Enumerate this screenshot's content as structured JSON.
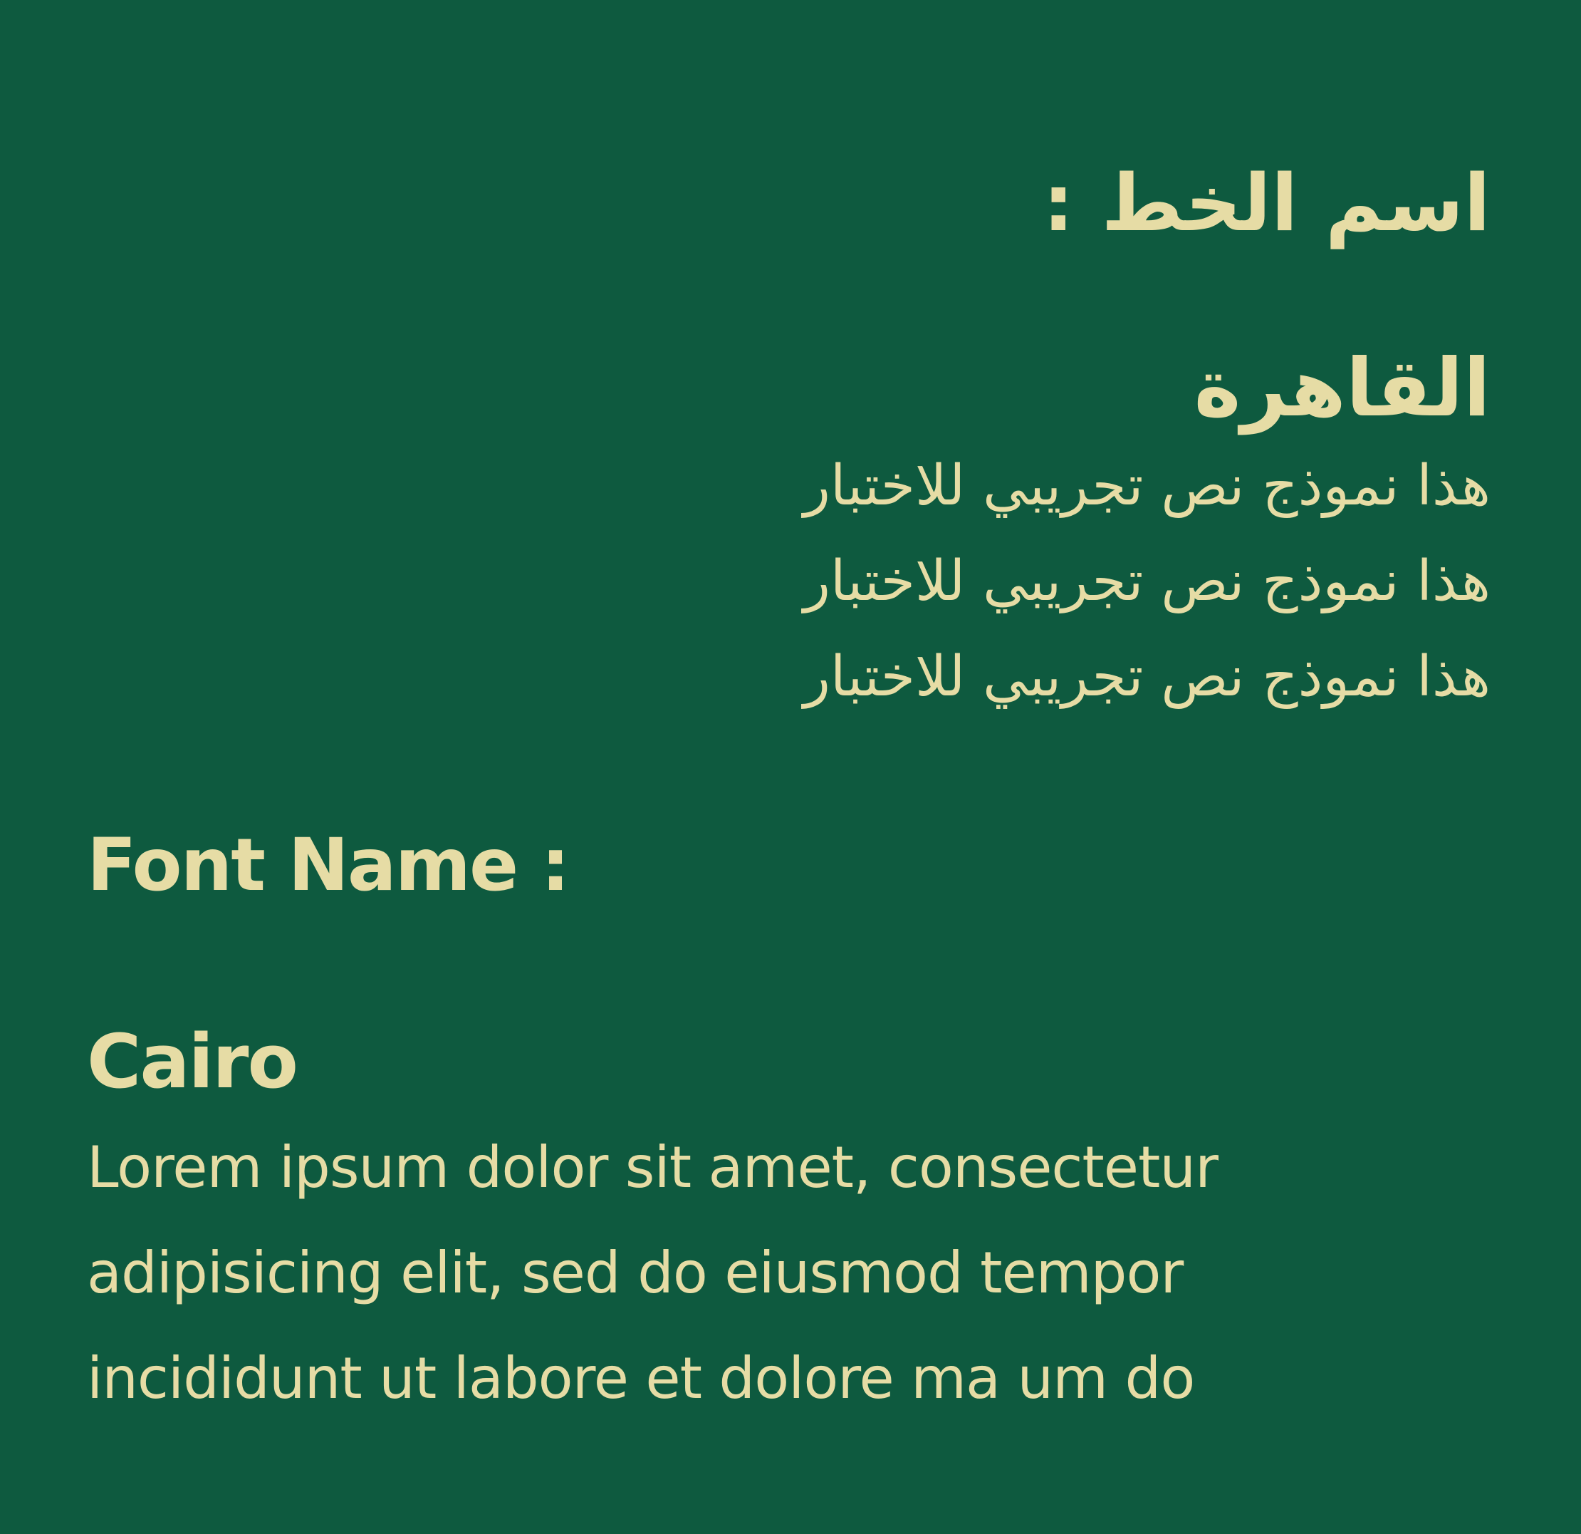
{
  "colors": {
    "background": "#0e5a3f",
    "text": "#e6dca5"
  },
  "arabic": {
    "heading": "اسم الخط :",
    "font_name": "القاهرة",
    "sample_lines": [
      "هذا نموذج نص تجريبي للاختبار",
      "هذا نموذج نص تجريبي للاختبار",
      "هذا نموذج نص تجريبي للاختبار"
    ]
  },
  "english": {
    "heading": "Font Name :",
    "font_name": "Cairo",
    "sample_lines": [
      "Lorem ipsum dolor sit amet, consectetur",
      "adipisicing elit, sed do eiusmod tempor",
      "incididunt ut labore et dolore ma  um do"
    ]
  }
}
